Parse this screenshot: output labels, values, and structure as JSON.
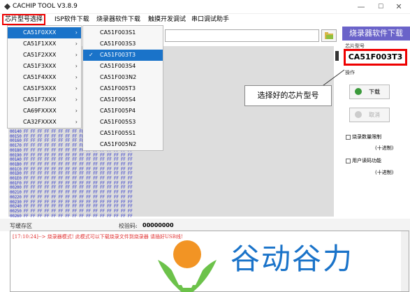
{
  "window": {
    "title": "CACHIP TOOL V3.8.9",
    "minimize": "—",
    "maximize": "☐",
    "close": "✕"
  },
  "menubar": {
    "items": [
      "芯片型号选择",
      "ISP软件下载",
      "烧录器软件下载",
      "触摸开发调试",
      "串口调试助手"
    ]
  },
  "menu_level1": {
    "items": [
      "CA51F0XXX",
      "CA51F1XXX",
      "CA51F2XXX",
      "CA51F3XXX",
      "CA51F4XXX",
      "CA51F5XXX",
      "CA51F7XXX",
      "CA69FXXXX",
      "CA32FXXXX"
    ],
    "arrow": "›"
  },
  "menu_level2": {
    "items": [
      "CA51F003S1",
      "CA51F003S3",
      "CA51F003T3",
      "CA51F003S4",
      "CA51F003N2",
      "CA51F005T3",
      "CA51F005S4",
      "CA51F005P4",
      "CA51F005S3",
      "CA51F005S1",
      "CA51F005N2"
    ],
    "selected_index": 2,
    "check": "✓"
  },
  "hex": {
    "addresses": [
      "00140",
      "00150",
      "00160",
      "00170",
      "00180",
      "00190",
      "001A0",
      "001B0",
      "001C0",
      "001D0",
      "001E0",
      "001F0",
      "00200",
      "00210",
      "00220",
      "00230",
      "00240",
      "00250",
      "00260"
    ],
    "byte": "FF"
  },
  "right_panel": {
    "banner": "烧录器软件下载",
    "chip_label": "芯片型号",
    "chip_value": "CA51F003T3",
    "operation_label": "操作",
    "download_label": "下载",
    "cancel_label": "取消",
    "count_limit_label": "烧录数量限制",
    "hex_unit_1": "(十进制)",
    "user_read_label": "用户读码功能",
    "hex_unit_2": "(十进制)"
  },
  "annotation": {
    "text": "选择好的芯片型号"
  },
  "status": {
    "write_label": "写缓存区",
    "checksum_label": "校验码:",
    "checksum_value": "00000000"
  },
  "log": {
    "line": "[17:10:24]--> 烧录器模式! 此模式可以下载烧录文件到烧录器 请插好USB线!"
  },
  "logo": {
    "text": "谷动谷力"
  },
  "colors": {
    "accent": "#6a63c9",
    "highlight": "#e00000",
    "selected": "#1a73c9",
    "logo_orange": "#f29424",
    "logo_green": "#6cc24a"
  }
}
